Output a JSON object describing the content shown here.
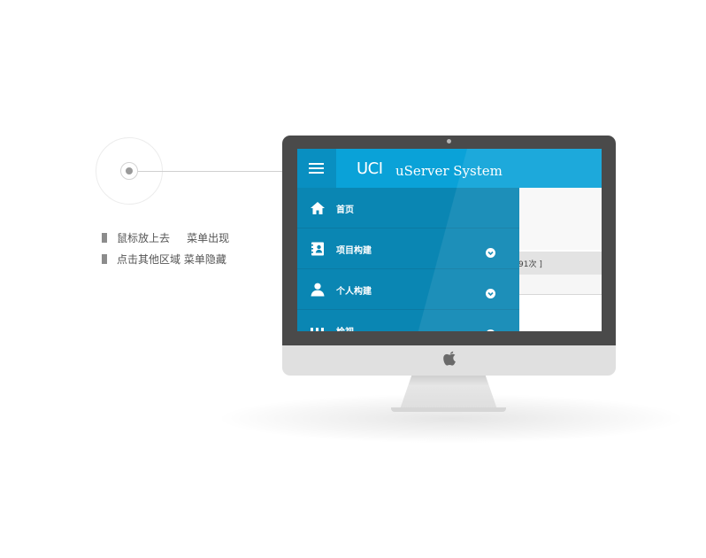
{
  "legend": {
    "items": [
      {
        "label": "鼠标放上去     菜单出现"
      },
      {
        "label": "点击其他区域 菜单隐藏"
      }
    ]
  },
  "app": {
    "logo": "UCI",
    "title": "uServer System",
    "background_strip_text": "91次 ]"
  },
  "menu": {
    "items": [
      {
        "label": "首页",
        "icon": "home-icon",
        "has_chevron": false
      },
      {
        "label": "项目构建",
        "icon": "project-book-icon",
        "has_chevron": true
      },
      {
        "label": "个人构建",
        "icon": "user-icon",
        "has_chevron": true
      },
      {
        "label": "检视",
        "icon": "inspect-icon",
        "has_chevron": true
      }
    ]
  },
  "colors": {
    "header": "#0aa2d8",
    "menu_toggle": "#098fc1",
    "menu": "#0a86b3",
    "bezel": "#4a4a4a"
  }
}
